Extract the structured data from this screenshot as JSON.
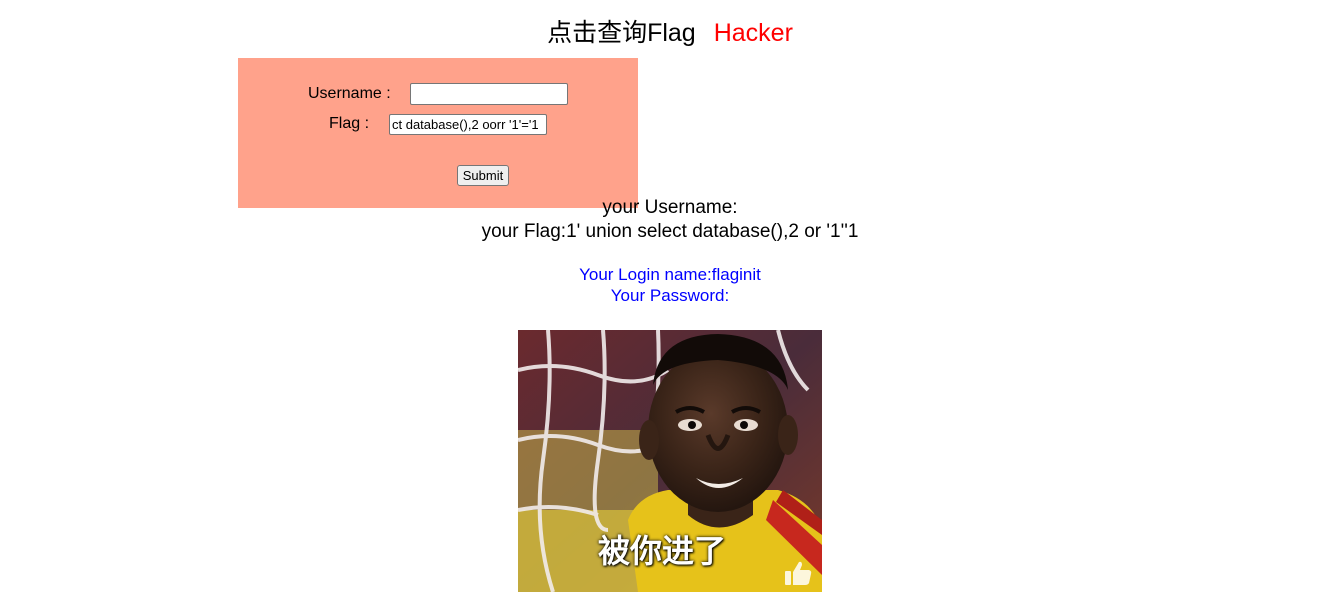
{
  "header": {
    "title": "点击查询Flag",
    "tag": "Hacker"
  },
  "form": {
    "username_label": "Username :",
    "username_value": "",
    "flag_label": "Flag :",
    "flag_value": "ct database(),2 oorr '1'='1",
    "submit_label": "Submit"
  },
  "result": {
    "username_line": "your Username:",
    "flag_line": "your Flag:1' union select database(),2 or '1''1"
  },
  "login": {
    "name_line": "Your Login name:flaginit",
    "password_line": "Your Password:"
  },
  "meme": {
    "caption": "被你进了",
    "thumb_icon": "thumbs-up-icon"
  },
  "colors": {
    "panel_bg": "#ffa28b",
    "hacker_text": "#ff0000",
    "login_text": "#0000ff"
  }
}
